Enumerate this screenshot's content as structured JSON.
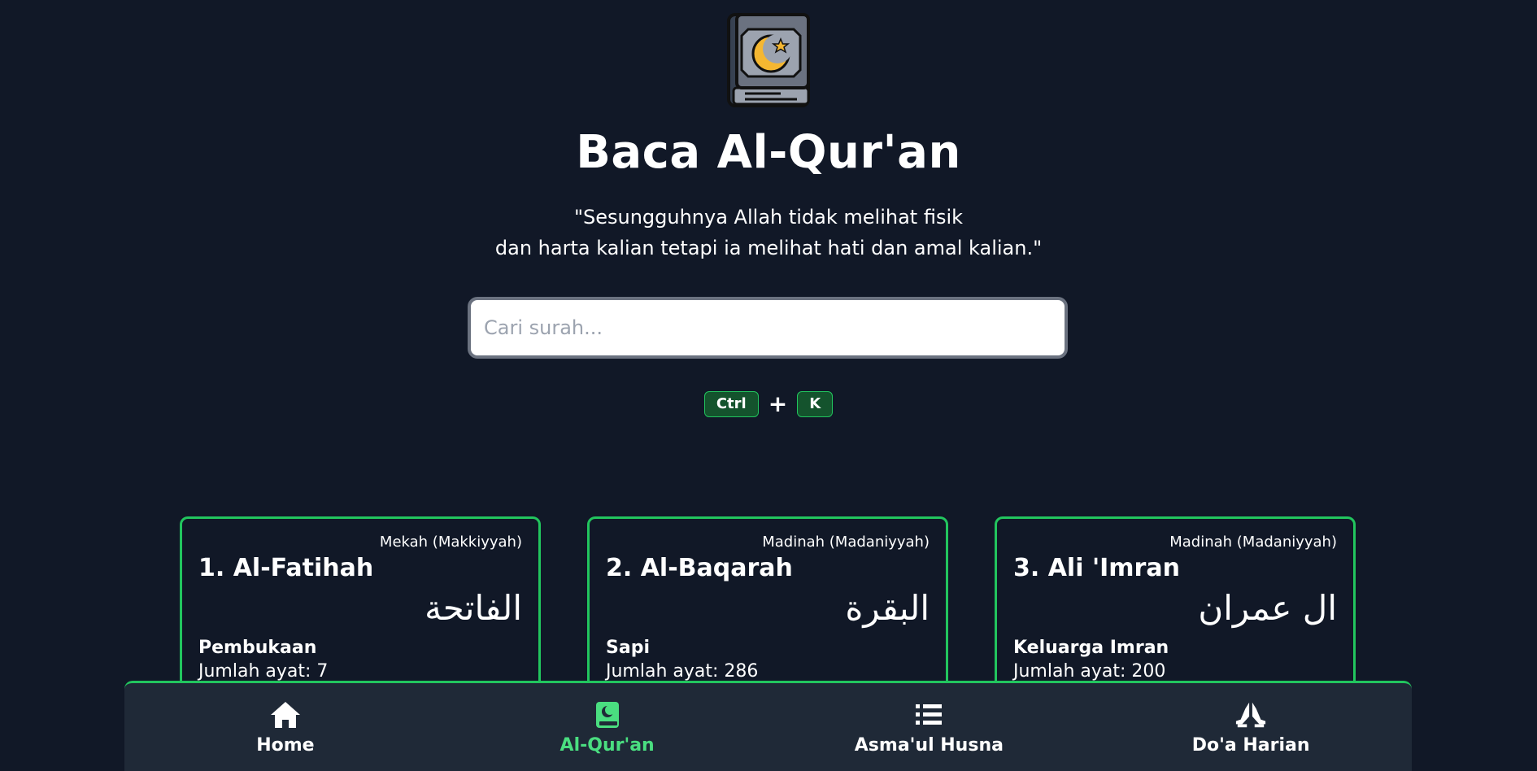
{
  "app": {
    "title": "Baca Al-Qur'an",
    "quote_line1": "\"Sesungguhnya Allah tidak melihat fisik",
    "quote_line2": "dan harta kalian tetapi ia melihat hati dan amal kalian.\""
  },
  "search": {
    "placeholder": "Cari surah...",
    "value": ""
  },
  "shortcut": {
    "key1": "Ctrl",
    "plus": "+",
    "key2": "K"
  },
  "surahs": [
    {
      "number_name": "1. Al-Fatihah",
      "place": "Mekah (Makkiyyah)",
      "arabic": "الفاتحة",
      "meaning": "Pembukaan",
      "verses": "Jumlah ayat: 7"
    },
    {
      "number_name": "2. Al-Baqarah",
      "place": "Madinah (Madaniyyah)",
      "arabic": "البقرة",
      "meaning": "Sapi",
      "verses": "Jumlah ayat: 286"
    },
    {
      "number_name": "3. Ali 'Imran",
      "place": "Madinah (Madaniyyah)",
      "arabic": "ال عمران",
      "meaning": "Keluarga Imran",
      "verses": "Jumlah ayat: 200"
    }
  ],
  "nav": {
    "items": [
      {
        "label": "Home",
        "icon": "home-icon",
        "active": false
      },
      {
        "label": "Al-Qur'an",
        "icon": "quran-icon",
        "active": true
      },
      {
        "label": "Asma'ul Husna",
        "icon": "list-icon",
        "active": false
      },
      {
        "label": "Do'a Harian",
        "icon": "praying-hands-icon",
        "active": false
      }
    ]
  },
  "colors": {
    "background": "#111827",
    "accent": "#22c55e",
    "active_nav": "#4ade80",
    "nav_bg": "#1f2937"
  }
}
